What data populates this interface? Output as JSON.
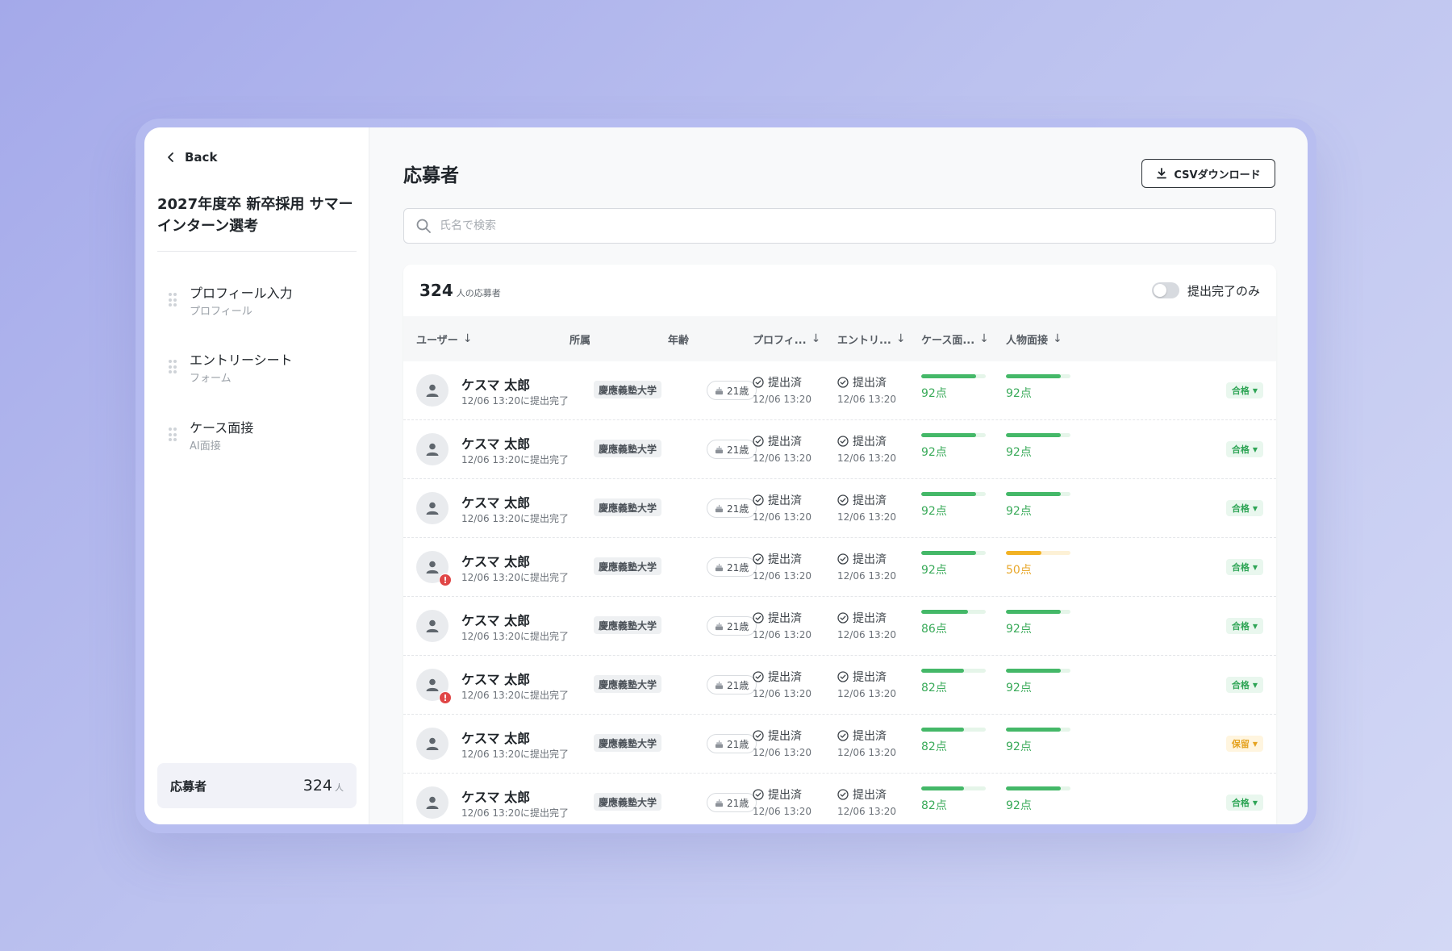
{
  "sidebar": {
    "back_label": "Back",
    "project_title": "2027年度卒 新卒採用 サマーインターン選考",
    "steps": [
      {
        "title": "プロフィール入力",
        "sub": "プロフィール"
      },
      {
        "title": "エントリーシート",
        "sub": "フォーム"
      },
      {
        "title": "ケース面接",
        "sub": "AI面接"
      }
    ],
    "applicants": {
      "label": "応募者",
      "count": "324",
      "unit": "人"
    }
  },
  "main": {
    "title": "応募者",
    "csv_button": "CSVダウンロード",
    "search_placeholder": "氏名で検索",
    "count": "324",
    "count_suffix": "人の応募者",
    "filter_label": "提出完了のみ",
    "columns": [
      {
        "label": "ユーザー",
        "arrow": "↓"
      },
      {
        "label": "所属",
        "arrow": ""
      },
      {
        "label": "年齢",
        "arrow": ""
      },
      {
        "label": "プロフィ...",
        "arrow": "↓"
      },
      {
        "label": "エントリ...",
        "arrow": "↓"
      },
      {
        "label": "ケース面...",
        "arrow": "↓"
      },
      {
        "label": "人物面接",
        "arrow": "↓"
      }
    ],
    "rows": [
      {
        "name": "ケスマ 太郎",
        "sub": "12/06 13:20に提出完了",
        "school": "慶應義塾大学",
        "age": "21歳",
        "profile": "提出済",
        "profile_time": "12/06 13:20",
        "entry": "提出済",
        "entry_time": "12/06 13:20",
        "case_score": "92点",
        "case_pct": 0.85,
        "case_color": "green",
        "person_score": "92点",
        "person_pct": 0.85,
        "person_color": "green",
        "status": "合格",
        "status_type": "pass",
        "warning": false
      },
      {
        "name": "ケスマ 太郎",
        "sub": "12/06 13:20に提出完了",
        "school": "慶應義塾大学",
        "age": "21歳",
        "profile": "提出済",
        "profile_time": "12/06 13:20",
        "entry": "提出済",
        "entry_time": "12/06 13:20",
        "case_score": "92点",
        "case_pct": 0.85,
        "case_color": "green",
        "person_score": "92点",
        "person_pct": 0.85,
        "person_color": "green",
        "status": "合格",
        "status_type": "pass",
        "warning": false
      },
      {
        "name": "ケスマ 太郎",
        "sub": "12/06 13:20に提出完了",
        "school": "慶應義塾大学",
        "age": "21歳",
        "profile": "提出済",
        "profile_time": "12/06 13:20",
        "entry": "提出済",
        "entry_time": "12/06 13:20",
        "case_score": "92点",
        "case_pct": 0.85,
        "case_color": "green",
        "person_score": "92点",
        "person_pct": 0.85,
        "person_color": "green",
        "status": "合格",
        "status_type": "pass",
        "warning": false
      },
      {
        "name": "ケスマ 太郎",
        "sub": "12/06 13:20に提出完了",
        "school": "慶應義塾大学",
        "age": "21歳",
        "profile": "提出済",
        "profile_time": "12/06 13:20",
        "entry": "提出済",
        "entry_time": "12/06 13:20",
        "case_score": "92点",
        "case_pct": 0.85,
        "case_color": "green",
        "person_score": "50点",
        "person_pct": 0.55,
        "person_color": "yellow",
        "status": "合格",
        "status_type": "pass",
        "warning": true
      },
      {
        "name": "ケスマ 太郎",
        "sub": "12/06 13:20に提出完了",
        "school": "慶應義塾大学",
        "age": "21歳",
        "profile": "提出済",
        "profile_time": "12/06 13:20",
        "entry": "提出済",
        "entry_time": "12/06 13:20",
        "case_score": "86点",
        "case_pct": 0.72,
        "case_color": "green",
        "person_score": "92点",
        "person_pct": 0.85,
        "person_color": "green",
        "status": "合格",
        "status_type": "pass",
        "warning": false
      },
      {
        "name": "ケスマ 太郎",
        "sub": "12/06 13:20に提出完了",
        "school": "慶應義塾大学",
        "age": "21歳",
        "profile": "提出済",
        "profile_time": "12/06 13:20",
        "entry": "提出済",
        "entry_time": "12/06 13:20",
        "case_score": "82点",
        "case_pct": 0.66,
        "case_color": "green",
        "person_score": "92点",
        "person_pct": 0.85,
        "person_color": "green",
        "status": "合格",
        "status_type": "pass",
        "warning": true
      },
      {
        "name": "ケスマ 太郎",
        "sub": "12/06 13:20に提出完了",
        "school": "慶應義塾大学",
        "age": "21歳",
        "profile": "提出済",
        "profile_time": "12/06 13:20",
        "entry": "提出済",
        "entry_time": "12/06 13:20",
        "case_score": "82点",
        "case_pct": 0.66,
        "case_color": "green",
        "person_score": "92点",
        "person_pct": 0.85,
        "person_color": "green",
        "status": "保留",
        "status_type": "hold",
        "warning": false
      },
      {
        "name": "ケスマ 太郎",
        "sub": "12/06 13:20に提出完了",
        "school": "慶應義塾大学",
        "age": "21歳",
        "profile": "提出済",
        "profile_time": "12/06 13:20",
        "entry": "提出済",
        "entry_time": "12/06 13:20",
        "case_score": "82点",
        "case_pct": 0.66,
        "case_color": "green",
        "person_score": "92点",
        "person_pct": 0.85,
        "person_color": "green",
        "status": "合格",
        "status_type": "pass",
        "warning": false
      }
    ]
  },
  "colors": {
    "accent_green": "#44b868",
    "accent_yellow": "#f2b224",
    "warning_red": "#e04646",
    "background": "#a4a9ea"
  },
  "icons": {
    "back": "chevron-left-icon",
    "download": "download-icon",
    "search": "search-icon",
    "avatar": "user-icon",
    "age": "cake-icon",
    "check": "check-circle-icon",
    "drag": "drag-handle-icon",
    "warning": "alert-icon"
  }
}
